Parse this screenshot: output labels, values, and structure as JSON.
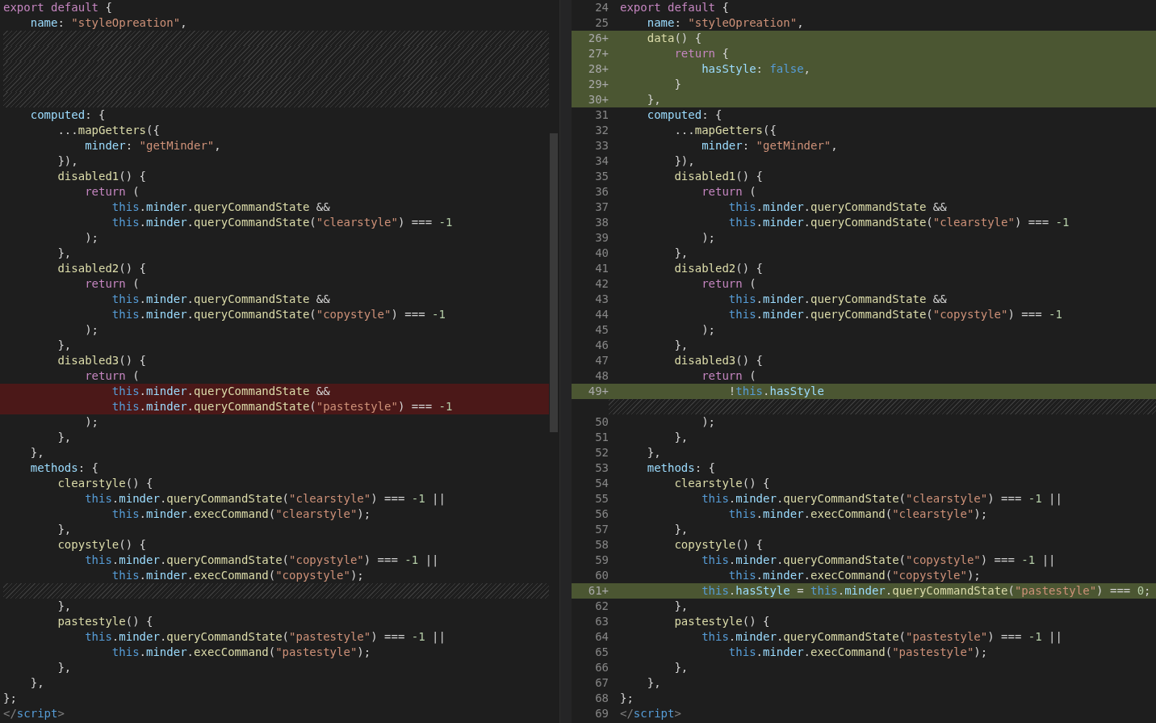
{
  "left_pane": {
    "rows": [
      {
        "kind": "unchanged",
        "tokens": [
          {
            "kind": "keyword",
            "text": "export default"
          },
          {
            "kind": "plain",
            "text": " {"
          }
        ]
      },
      {
        "kind": "unchanged",
        "tokens": [
          {
            "kind": "property",
            "text": "    name"
          },
          {
            "kind": "plain",
            "text": ": "
          },
          {
            "kind": "string",
            "text": "\"styleOpreation\""
          },
          {
            "kind": "plain",
            "text": ","
          }
        ]
      },
      {
        "kind": "filler"
      },
      {
        "kind": "filler"
      },
      {
        "kind": "filler"
      },
      {
        "kind": "filler"
      },
      {
        "kind": "filler"
      },
      {
        "kind": "unchanged",
        "tokens": [
          {
            "kind": "property",
            "text": "    computed"
          },
          {
            "kind": "plain",
            "text": ": {"
          }
        ]
      },
      {
        "kind": "unchanged",
        "tokens": [
          {
            "kind": "plain",
            "text": "        ..."
          },
          {
            "kind": "function",
            "text": "mapGetters"
          },
          {
            "kind": "plain",
            "text": "({"
          }
        ]
      },
      {
        "kind": "unchanged",
        "tokens": [
          {
            "kind": "property",
            "text": "            minder"
          },
          {
            "kind": "plain",
            "text": ": "
          },
          {
            "kind": "string",
            "text": "\"getMinder\""
          },
          {
            "kind": "plain",
            "text": ","
          }
        ]
      },
      {
        "kind": "unchanged",
        "tokens": [
          {
            "kind": "plain",
            "text": "        }),"
          }
        ]
      },
      {
        "kind": "unchanged",
        "tokens": [
          {
            "kind": "function",
            "text": "        disabled1"
          },
          {
            "kind": "plain",
            "text": "() {"
          }
        ]
      },
      {
        "kind": "unchanged",
        "tokens": [
          {
            "kind": "keyword",
            "text": "            return"
          },
          {
            "kind": "plain",
            "text": " ("
          }
        ]
      },
      {
        "kind": "unchanged",
        "tokens": [
          {
            "kind": "constant",
            "text": "                this"
          },
          {
            "kind": "plain",
            "text": "."
          },
          {
            "kind": "property",
            "text": "minder"
          },
          {
            "kind": "plain",
            "text": "."
          },
          {
            "kind": "function",
            "text": "queryCommandState"
          },
          {
            "kind": "plain",
            "text": " &&"
          }
        ]
      },
      {
        "kind": "unchanged",
        "tokens": [
          {
            "kind": "constant",
            "text": "                this"
          },
          {
            "kind": "plain",
            "text": "."
          },
          {
            "kind": "property",
            "text": "minder"
          },
          {
            "kind": "plain",
            "text": "."
          },
          {
            "kind": "function",
            "text": "queryCommandState"
          },
          {
            "kind": "plain",
            "text": "("
          },
          {
            "kind": "string",
            "text": "\"clearstyle\""
          },
          {
            "kind": "plain",
            "text": ") === "
          },
          {
            "kind": "number",
            "text": "-1"
          }
        ]
      },
      {
        "kind": "unchanged",
        "tokens": [
          {
            "kind": "plain",
            "text": "            );"
          }
        ]
      },
      {
        "kind": "unchanged",
        "tokens": [
          {
            "kind": "plain",
            "text": "        },"
          }
        ]
      },
      {
        "kind": "unchanged",
        "tokens": [
          {
            "kind": "function",
            "text": "        disabled2"
          },
          {
            "kind": "plain",
            "text": "() {"
          }
        ]
      },
      {
        "kind": "unchanged",
        "tokens": [
          {
            "kind": "keyword",
            "text": "            return"
          },
          {
            "kind": "plain",
            "text": " ("
          }
        ]
      },
      {
        "kind": "unchanged",
        "tokens": [
          {
            "kind": "constant",
            "text": "                this"
          },
          {
            "kind": "plain",
            "text": "."
          },
          {
            "kind": "property",
            "text": "minder"
          },
          {
            "kind": "plain",
            "text": "."
          },
          {
            "kind": "function",
            "text": "queryCommandState"
          },
          {
            "kind": "plain",
            "text": " &&"
          }
        ]
      },
      {
        "kind": "unchanged",
        "tokens": [
          {
            "kind": "constant",
            "text": "                this"
          },
          {
            "kind": "plain",
            "text": "."
          },
          {
            "kind": "property",
            "text": "minder"
          },
          {
            "kind": "plain",
            "text": "."
          },
          {
            "kind": "function",
            "text": "queryCommandState"
          },
          {
            "kind": "plain",
            "text": "("
          },
          {
            "kind": "string",
            "text": "\"copystyle\""
          },
          {
            "kind": "plain",
            "text": ") === "
          },
          {
            "kind": "number",
            "text": "-1"
          }
        ]
      },
      {
        "kind": "unchanged",
        "tokens": [
          {
            "kind": "plain",
            "text": "            );"
          }
        ]
      },
      {
        "kind": "unchanged",
        "tokens": [
          {
            "kind": "plain",
            "text": "        },"
          }
        ]
      },
      {
        "kind": "unchanged",
        "tokens": [
          {
            "kind": "function",
            "text": "        disabled3"
          },
          {
            "kind": "plain",
            "text": "() {"
          }
        ]
      },
      {
        "kind": "unchanged",
        "tokens": [
          {
            "kind": "keyword",
            "text": "            return"
          },
          {
            "kind": "plain",
            "text": " ("
          }
        ]
      },
      {
        "kind": "removed",
        "tokens": [
          {
            "kind": "constant",
            "text": "                this"
          },
          {
            "kind": "plain",
            "text": "."
          },
          {
            "kind": "property",
            "text": "minder"
          },
          {
            "kind": "plain",
            "text": "."
          },
          {
            "kind": "function",
            "text": "queryCommandState"
          },
          {
            "kind": "plain",
            "text": " &&"
          }
        ]
      },
      {
        "kind": "removed",
        "tokens": [
          {
            "kind": "constant",
            "text": "                this"
          },
          {
            "kind": "plain",
            "text": "."
          },
          {
            "kind": "property",
            "text": "minder"
          },
          {
            "kind": "plain",
            "text": "."
          },
          {
            "kind": "function",
            "text": "queryCommandState"
          },
          {
            "kind": "plain",
            "text": "("
          },
          {
            "kind": "string",
            "text": "\"pastestyle\""
          },
          {
            "kind": "plain",
            "text": ") === "
          },
          {
            "kind": "number",
            "text": "-1"
          }
        ]
      },
      {
        "kind": "unchanged",
        "tokens": [
          {
            "kind": "plain",
            "text": "            );"
          }
        ]
      },
      {
        "kind": "unchanged",
        "tokens": [
          {
            "kind": "plain",
            "text": "        },"
          }
        ]
      },
      {
        "kind": "unchanged",
        "tokens": [
          {
            "kind": "plain",
            "text": "    },"
          }
        ]
      },
      {
        "kind": "unchanged",
        "tokens": [
          {
            "kind": "property",
            "text": "    methods"
          },
          {
            "kind": "plain",
            "text": ": {"
          }
        ]
      },
      {
        "kind": "unchanged",
        "tokens": [
          {
            "kind": "function",
            "text": "        clearstyle"
          },
          {
            "kind": "plain",
            "text": "() {"
          }
        ]
      },
      {
        "kind": "unchanged",
        "tokens": [
          {
            "kind": "constant",
            "text": "            this"
          },
          {
            "kind": "plain",
            "text": "."
          },
          {
            "kind": "property",
            "text": "minder"
          },
          {
            "kind": "plain",
            "text": "."
          },
          {
            "kind": "function",
            "text": "queryCommandState"
          },
          {
            "kind": "plain",
            "text": "("
          },
          {
            "kind": "string",
            "text": "\"clearstyle\""
          },
          {
            "kind": "plain",
            "text": ") === "
          },
          {
            "kind": "number",
            "text": "-1"
          },
          {
            "kind": "plain",
            "text": " ||"
          }
        ]
      },
      {
        "kind": "unchanged",
        "tokens": [
          {
            "kind": "constant",
            "text": "                this"
          },
          {
            "kind": "plain",
            "text": "."
          },
          {
            "kind": "property",
            "text": "minder"
          },
          {
            "kind": "plain",
            "text": "."
          },
          {
            "kind": "function",
            "text": "execCommand"
          },
          {
            "kind": "plain",
            "text": "("
          },
          {
            "kind": "string",
            "text": "\"clearstyle\""
          },
          {
            "kind": "plain",
            "text": ");"
          }
        ]
      },
      {
        "kind": "unchanged",
        "tokens": [
          {
            "kind": "plain",
            "text": "        },"
          }
        ]
      },
      {
        "kind": "unchanged",
        "tokens": [
          {
            "kind": "function",
            "text": "        copystyle"
          },
          {
            "kind": "plain",
            "text": "() {"
          }
        ]
      },
      {
        "kind": "unchanged",
        "tokens": [
          {
            "kind": "constant",
            "text": "            this"
          },
          {
            "kind": "plain",
            "text": "."
          },
          {
            "kind": "property",
            "text": "minder"
          },
          {
            "kind": "plain",
            "text": "."
          },
          {
            "kind": "function",
            "text": "queryCommandState"
          },
          {
            "kind": "plain",
            "text": "("
          },
          {
            "kind": "string",
            "text": "\"copystyle\""
          },
          {
            "kind": "plain",
            "text": ") === "
          },
          {
            "kind": "number",
            "text": "-1"
          },
          {
            "kind": "plain",
            "text": " ||"
          }
        ]
      },
      {
        "kind": "unchanged",
        "tokens": [
          {
            "kind": "constant",
            "text": "                this"
          },
          {
            "kind": "plain",
            "text": "."
          },
          {
            "kind": "property",
            "text": "minder"
          },
          {
            "kind": "plain",
            "text": "."
          },
          {
            "kind": "function",
            "text": "execCommand"
          },
          {
            "kind": "plain",
            "text": "("
          },
          {
            "kind": "string",
            "text": "\"copystyle\""
          },
          {
            "kind": "plain",
            "text": ");"
          }
        ]
      },
      {
        "kind": "filler"
      },
      {
        "kind": "unchanged",
        "tokens": [
          {
            "kind": "plain",
            "text": "        },"
          }
        ]
      },
      {
        "kind": "unchanged",
        "tokens": [
          {
            "kind": "function",
            "text": "        pastestyle"
          },
          {
            "kind": "plain",
            "text": "() {"
          }
        ]
      },
      {
        "kind": "unchanged",
        "tokens": [
          {
            "kind": "constant",
            "text": "            this"
          },
          {
            "kind": "plain",
            "text": "."
          },
          {
            "kind": "property",
            "text": "minder"
          },
          {
            "kind": "plain",
            "text": "."
          },
          {
            "kind": "function",
            "text": "queryCommandState"
          },
          {
            "kind": "plain",
            "text": "("
          },
          {
            "kind": "string",
            "text": "\"pastestyle\""
          },
          {
            "kind": "plain",
            "text": ") === "
          },
          {
            "kind": "number",
            "text": "-1"
          },
          {
            "kind": "plain",
            "text": " ||"
          }
        ]
      },
      {
        "kind": "unchanged",
        "tokens": [
          {
            "kind": "constant",
            "text": "                this"
          },
          {
            "kind": "plain",
            "text": "."
          },
          {
            "kind": "property",
            "text": "minder"
          },
          {
            "kind": "plain",
            "text": "."
          },
          {
            "kind": "function",
            "text": "execCommand"
          },
          {
            "kind": "plain",
            "text": "("
          },
          {
            "kind": "string",
            "text": "\"pastestyle\""
          },
          {
            "kind": "plain",
            "text": ");"
          }
        ]
      },
      {
        "kind": "unchanged",
        "tokens": [
          {
            "kind": "plain",
            "text": "        },"
          }
        ]
      },
      {
        "kind": "unchanged",
        "tokens": [
          {
            "kind": "plain",
            "text": "    },"
          }
        ]
      },
      {
        "kind": "unchanged",
        "tokens": [
          {
            "kind": "plain",
            "text": "};"
          }
        ]
      },
      {
        "kind": "unchanged",
        "tokens": [
          {
            "kind": "punctuation",
            "text": "</"
          },
          {
            "kind": "constant",
            "text": "script"
          },
          {
            "kind": "punctuation",
            "text": ">"
          }
        ]
      }
    ]
  },
  "right_pane": {
    "rows": [
      {
        "kind": "unchanged",
        "number": "24",
        "tokens": [
          {
            "kind": "keyword",
            "text": "export default"
          },
          {
            "kind": "plain",
            "text": " {"
          }
        ]
      },
      {
        "kind": "unchanged",
        "number": "25",
        "tokens": [
          {
            "kind": "property",
            "text": "    name"
          },
          {
            "kind": "plain",
            "text": ": "
          },
          {
            "kind": "string",
            "text": "\"styleOpreation\""
          },
          {
            "kind": "plain",
            "text": ","
          }
        ]
      },
      {
        "kind": "added",
        "number": "26+",
        "tokens": [
          {
            "kind": "function",
            "text": "    data"
          },
          {
            "kind": "plain",
            "text": "() {"
          }
        ]
      },
      {
        "kind": "added",
        "number": "27+",
        "tokens": [
          {
            "kind": "keyword",
            "text": "        return"
          },
          {
            "kind": "plain",
            "text": " {"
          }
        ]
      },
      {
        "kind": "added",
        "number": "28+",
        "tokens": [
          {
            "kind": "property",
            "text": "            hasStyle"
          },
          {
            "kind": "plain",
            "text": ": "
          },
          {
            "kind": "constant",
            "text": "false"
          },
          {
            "kind": "plain",
            "text": ","
          }
        ]
      },
      {
        "kind": "added",
        "number": "29+",
        "tokens": [
          {
            "kind": "plain",
            "text": "        }"
          }
        ]
      },
      {
        "kind": "added",
        "number": "30+",
        "tokens": [
          {
            "kind": "plain",
            "text": "    },"
          }
        ]
      },
      {
        "kind": "unchanged",
        "number": "31",
        "tokens": [
          {
            "kind": "property",
            "text": "    computed"
          },
          {
            "kind": "plain",
            "text": ": {"
          }
        ]
      },
      {
        "kind": "unchanged",
        "number": "32",
        "tokens": [
          {
            "kind": "plain",
            "text": "        ..."
          },
          {
            "kind": "function",
            "text": "mapGetters"
          },
          {
            "kind": "plain",
            "text": "({"
          }
        ]
      },
      {
        "kind": "unchanged",
        "number": "33",
        "tokens": [
          {
            "kind": "property",
            "text": "            minder"
          },
          {
            "kind": "plain",
            "text": ": "
          },
          {
            "kind": "string",
            "text": "\"getMinder\""
          },
          {
            "kind": "plain",
            "text": ","
          }
        ]
      },
      {
        "kind": "unchanged",
        "number": "34",
        "tokens": [
          {
            "kind": "plain",
            "text": "        }),"
          }
        ]
      },
      {
        "kind": "unchanged",
        "number": "35",
        "tokens": [
          {
            "kind": "function",
            "text": "        disabled1"
          },
          {
            "kind": "plain",
            "text": "() {"
          }
        ]
      },
      {
        "kind": "unchanged",
        "number": "36",
        "tokens": [
          {
            "kind": "keyword",
            "text": "            return"
          },
          {
            "kind": "plain",
            "text": " ("
          }
        ]
      },
      {
        "kind": "unchanged",
        "number": "37",
        "tokens": [
          {
            "kind": "constant",
            "text": "                this"
          },
          {
            "kind": "plain",
            "text": "."
          },
          {
            "kind": "property",
            "text": "minder"
          },
          {
            "kind": "plain",
            "text": "."
          },
          {
            "kind": "function",
            "text": "queryCommandState"
          },
          {
            "kind": "plain",
            "text": " &&"
          }
        ]
      },
      {
        "kind": "unchanged",
        "number": "38",
        "tokens": [
          {
            "kind": "constant",
            "text": "                this"
          },
          {
            "kind": "plain",
            "text": "."
          },
          {
            "kind": "property",
            "text": "minder"
          },
          {
            "kind": "plain",
            "text": "."
          },
          {
            "kind": "function",
            "text": "queryCommandState"
          },
          {
            "kind": "plain",
            "text": "("
          },
          {
            "kind": "string",
            "text": "\"clearstyle\""
          },
          {
            "kind": "plain",
            "text": ") === "
          },
          {
            "kind": "number",
            "text": "-1"
          }
        ]
      },
      {
        "kind": "unchanged",
        "number": "39",
        "tokens": [
          {
            "kind": "plain",
            "text": "            );"
          }
        ]
      },
      {
        "kind": "unchanged",
        "number": "40",
        "tokens": [
          {
            "kind": "plain",
            "text": "        },"
          }
        ]
      },
      {
        "kind": "unchanged",
        "number": "41",
        "tokens": [
          {
            "kind": "function",
            "text": "        disabled2"
          },
          {
            "kind": "plain",
            "text": "() {"
          }
        ]
      },
      {
        "kind": "unchanged",
        "number": "42",
        "tokens": [
          {
            "kind": "keyword",
            "text": "            return"
          },
          {
            "kind": "plain",
            "text": " ("
          }
        ]
      },
      {
        "kind": "unchanged",
        "number": "43",
        "tokens": [
          {
            "kind": "constant",
            "text": "                this"
          },
          {
            "kind": "plain",
            "text": "."
          },
          {
            "kind": "property",
            "text": "minder"
          },
          {
            "kind": "plain",
            "text": "."
          },
          {
            "kind": "function",
            "text": "queryCommandState"
          },
          {
            "kind": "plain",
            "text": " &&"
          }
        ]
      },
      {
        "kind": "unchanged",
        "number": "44",
        "tokens": [
          {
            "kind": "constant",
            "text": "                this"
          },
          {
            "kind": "plain",
            "text": "."
          },
          {
            "kind": "property",
            "text": "minder"
          },
          {
            "kind": "plain",
            "text": "."
          },
          {
            "kind": "function",
            "text": "queryCommandState"
          },
          {
            "kind": "plain",
            "text": "("
          },
          {
            "kind": "string",
            "text": "\"copystyle\""
          },
          {
            "kind": "plain",
            "text": ") === "
          },
          {
            "kind": "number",
            "text": "-1"
          }
        ]
      },
      {
        "kind": "unchanged",
        "number": "45",
        "tokens": [
          {
            "kind": "plain",
            "text": "            );"
          }
        ]
      },
      {
        "kind": "unchanged",
        "number": "46",
        "tokens": [
          {
            "kind": "plain",
            "text": "        },"
          }
        ]
      },
      {
        "kind": "unchanged",
        "number": "47",
        "tokens": [
          {
            "kind": "function",
            "text": "        disabled3"
          },
          {
            "kind": "plain",
            "text": "() {"
          }
        ]
      },
      {
        "kind": "unchanged",
        "number": "48",
        "tokens": [
          {
            "kind": "keyword",
            "text": "            return"
          },
          {
            "kind": "plain",
            "text": " ("
          }
        ]
      },
      {
        "kind": "added",
        "number": "49+",
        "tokens": [
          {
            "kind": "plain",
            "text": "                !"
          },
          {
            "kind": "constant",
            "text": "this"
          },
          {
            "kind": "plain",
            "text": "."
          },
          {
            "kind": "property",
            "text": "hasStyle"
          }
        ]
      },
      {
        "kind": "filler"
      },
      {
        "kind": "unchanged",
        "number": "50",
        "tokens": [
          {
            "kind": "plain",
            "text": "            );"
          }
        ]
      },
      {
        "kind": "unchanged",
        "number": "51",
        "tokens": [
          {
            "kind": "plain",
            "text": "        },"
          }
        ]
      },
      {
        "kind": "unchanged",
        "number": "52",
        "tokens": [
          {
            "kind": "plain",
            "text": "    },"
          }
        ]
      },
      {
        "kind": "unchanged",
        "number": "53",
        "tokens": [
          {
            "kind": "property",
            "text": "    methods"
          },
          {
            "kind": "plain",
            "text": ": {"
          }
        ]
      },
      {
        "kind": "unchanged",
        "number": "54",
        "tokens": [
          {
            "kind": "function",
            "text": "        clearstyle"
          },
          {
            "kind": "plain",
            "text": "() {"
          }
        ]
      },
      {
        "kind": "unchanged",
        "number": "55",
        "tokens": [
          {
            "kind": "constant",
            "text": "            this"
          },
          {
            "kind": "plain",
            "text": "."
          },
          {
            "kind": "property",
            "text": "minder"
          },
          {
            "kind": "plain",
            "text": "."
          },
          {
            "kind": "function",
            "text": "queryCommandState"
          },
          {
            "kind": "plain",
            "text": "("
          },
          {
            "kind": "string",
            "text": "\"clearstyle\""
          },
          {
            "kind": "plain",
            "text": ") === "
          },
          {
            "kind": "number",
            "text": "-1"
          },
          {
            "kind": "plain",
            "text": " ||"
          }
        ]
      },
      {
        "kind": "unchanged",
        "number": "56",
        "tokens": [
          {
            "kind": "constant",
            "text": "                this"
          },
          {
            "kind": "plain",
            "text": "."
          },
          {
            "kind": "property",
            "text": "minder"
          },
          {
            "kind": "plain",
            "text": "."
          },
          {
            "kind": "function",
            "text": "execCommand"
          },
          {
            "kind": "plain",
            "text": "("
          },
          {
            "kind": "string",
            "text": "\"clearstyle\""
          },
          {
            "kind": "plain",
            "text": ");"
          }
        ]
      },
      {
        "kind": "unchanged",
        "number": "57",
        "tokens": [
          {
            "kind": "plain",
            "text": "        },"
          }
        ]
      },
      {
        "kind": "unchanged",
        "number": "58",
        "tokens": [
          {
            "kind": "function",
            "text": "        copystyle"
          },
          {
            "kind": "plain",
            "text": "() {"
          }
        ]
      },
      {
        "kind": "unchanged",
        "number": "59",
        "tokens": [
          {
            "kind": "constant",
            "text": "            this"
          },
          {
            "kind": "plain",
            "text": "."
          },
          {
            "kind": "property",
            "text": "minder"
          },
          {
            "kind": "plain",
            "text": "."
          },
          {
            "kind": "function",
            "text": "queryCommandState"
          },
          {
            "kind": "plain",
            "text": "("
          },
          {
            "kind": "string",
            "text": "\"copystyle\""
          },
          {
            "kind": "plain",
            "text": ") === "
          },
          {
            "kind": "number",
            "text": "-1"
          },
          {
            "kind": "plain",
            "text": " ||"
          }
        ]
      },
      {
        "kind": "unchanged",
        "number": "60",
        "tokens": [
          {
            "kind": "constant",
            "text": "                this"
          },
          {
            "kind": "plain",
            "text": "."
          },
          {
            "kind": "property",
            "text": "minder"
          },
          {
            "kind": "plain",
            "text": "."
          },
          {
            "kind": "function",
            "text": "execCommand"
          },
          {
            "kind": "plain",
            "text": "("
          },
          {
            "kind": "string",
            "text": "\"copystyle\""
          },
          {
            "kind": "plain",
            "text": ");"
          }
        ]
      },
      {
        "kind": "added",
        "number": "61+",
        "tokens": [
          {
            "kind": "constant",
            "text": "            this"
          },
          {
            "kind": "plain",
            "text": "."
          },
          {
            "kind": "property",
            "text": "hasStyle"
          },
          {
            "kind": "plain",
            "text": " = "
          },
          {
            "kind": "constant",
            "text": "this"
          },
          {
            "kind": "plain",
            "text": "."
          },
          {
            "kind": "property",
            "text": "minder"
          },
          {
            "kind": "plain",
            "text": "."
          },
          {
            "kind": "function",
            "text": "queryCommandState"
          },
          {
            "kind": "plain",
            "text": "("
          },
          {
            "kind": "string",
            "text": "\"pastestyle\""
          },
          {
            "kind": "plain",
            "text": ") === "
          },
          {
            "kind": "number",
            "text": "0"
          },
          {
            "kind": "plain",
            "text": ";"
          }
        ]
      },
      {
        "kind": "unchanged",
        "number": "62",
        "tokens": [
          {
            "kind": "plain",
            "text": "        },"
          }
        ]
      },
      {
        "kind": "unchanged",
        "number": "63",
        "tokens": [
          {
            "kind": "function",
            "text": "        pastestyle"
          },
          {
            "kind": "plain",
            "text": "() {"
          }
        ]
      },
      {
        "kind": "unchanged",
        "number": "64",
        "tokens": [
          {
            "kind": "constant",
            "text": "            this"
          },
          {
            "kind": "plain",
            "text": "."
          },
          {
            "kind": "property",
            "text": "minder"
          },
          {
            "kind": "plain",
            "text": "."
          },
          {
            "kind": "function",
            "text": "queryCommandState"
          },
          {
            "kind": "plain",
            "text": "("
          },
          {
            "kind": "string",
            "text": "\"pastestyle\""
          },
          {
            "kind": "plain",
            "text": ") === "
          },
          {
            "kind": "number",
            "text": "-1"
          },
          {
            "kind": "plain",
            "text": " ||"
          }
        ]
      },
      {
        "kind": "unchanged",
        "number": "65",
        "tokens": [
          {
            "kind": "constant",
            "text": "                this"
          },
          {
            "kind": "plain",
            "text": "."
          },
          {
            "kind": "property",
            "text": "minder"
          },
          {
            "kind": "plain",
            "text": "."
          },
          {
            "kind": "function",
            "text": "execCommand"
          },
          {
            "kind": "plain",
            "text": "("
          },
          {
            "kind": "string",
            "text": "\"pastestyle\""
          },
          {
            "kind": "plain",
            "text": ");"
          }
        ]
      },
      {
        "kind": "unchanged",
        "number": "66",
        "tokens": [
          {
            "kind": "plain",
            "text": "        },"
          }
        ]
      },
      {
        "kind": "unchanged",
        "number": "67",
        "tokens": [
          {
            "kind": "plain",
            "text": "    },"
          }
        ]
      },
      {
        "kind": "unchanged",
        "number": "68",
        "tokens": [
          {
            "kind": "plain",
            "text": "};"
          }
        ]
      },
      {
        "kind": "unchanged",
        "number": "69",
        "tokens": [
          {
            "kind": "punctuation",
            "text": "</"
          },
          {
            "kind": "constant",
            "text": "script"
          },
          {
            "kind": "punctuation",
            "text": ">"
          }
        ]
      }
    ]
  }
}
